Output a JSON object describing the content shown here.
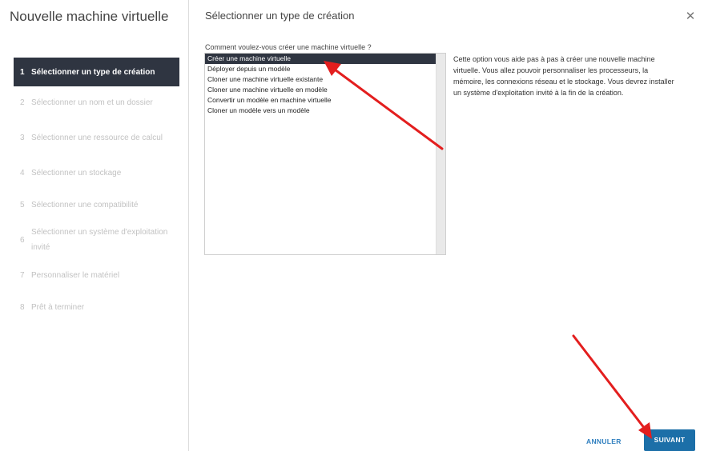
{
  "wizard": {
    "title": "Nouvelle machine virtuelle",
    "steps": [
      {
        "num": "1",
        "label": "Sélectionner un type de création"
      },
      {
        "num": "2",
        "label": "Sélectionner un nom et un dossier"
      },
      {
        "num": "3",
        "label": "Sélectionner une ressource de calcul"
      },
      {
        "num": "4",
        "label": "Sélectionner un stockage"
      },
      {
        "num": "5",
        "label": "Sélectionner une compatibilité"
      },
      {
        "num": "6",
        "label": "Sélectionner un système d'exploitation invité"
      },
      {
        "num": "7",
        "label": "Personnaliser le matériel"
      },
      {
        "num": "8",
        "label": "Prêt à terminer"
      }
    ]
  },
  "main": {
    "title": "Sélectionner un type de création",
    "question": "Comment voulez-vous créer une machine virtuelle ?",
    "options": [
      "Créer une machine virtuelle",
      "Déployer depuis un modèle",
      "Cloner une machine virtuelle existante",
      "Cloner une machine virtuelle en modèle",
      "Convertir un modèle en machine virtuelle",
      "Cloner un modèle vers un modèle"
    ],
    "selected_index": 0,
    "description": "Cette option vous aide pas à pas à créer une nouvelle machine virtuelle. Vous allez pouvoir personnaliser les processeurs, la mémoire, les connexions réseau et le stockage. Vous devrez installer un système d'exploitation invité à la fin de la création."
  },
  "footer": {
    "cancel_label": "ANNULER",
    "next_label": "SUIVANT"
  },
  "icons": {
    "close": "close-icon"
  },
  "colors": {
    "active_bg": "#2f3541",
    "primary_button": "#1c6fa8",
    "link_button": "#2f7fbf",
    "annotation_arrow": "#e31e1e"
  }
}
